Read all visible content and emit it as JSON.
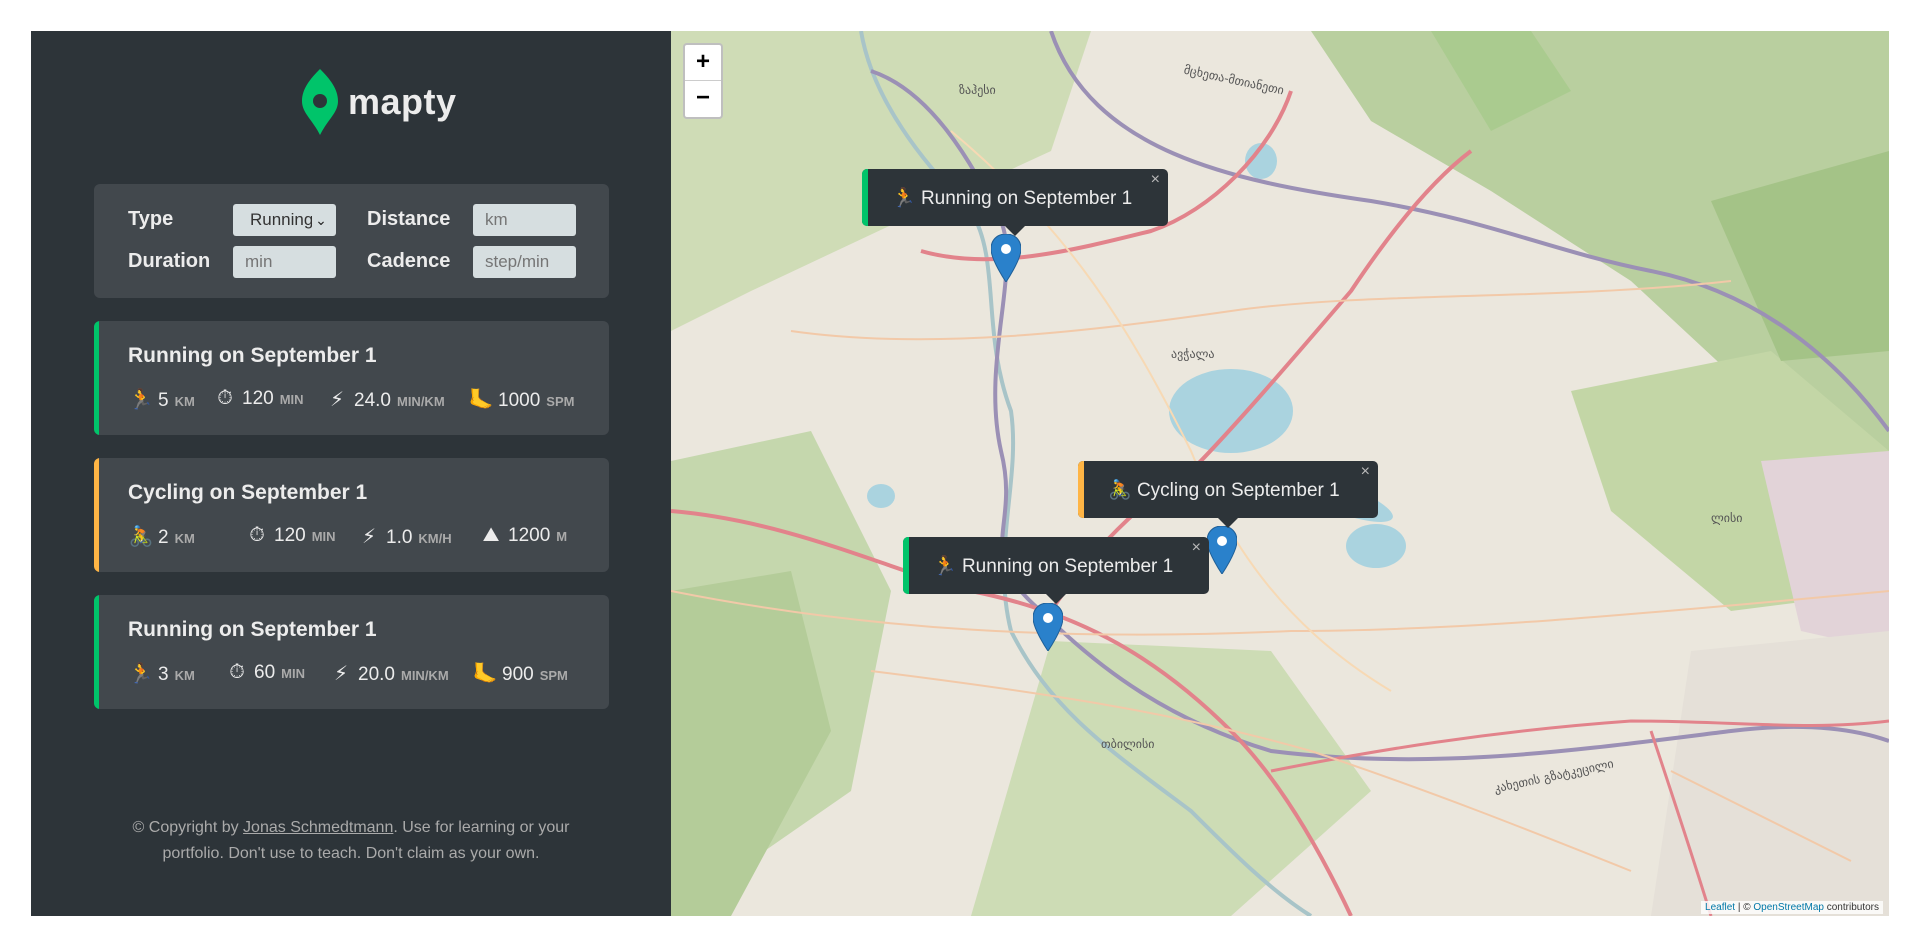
{
  "brand": {
    "name": "mapty",
    "accent": "#00c46a"
  },
  "form": {
    "type_label": "Type",
    "type_value": "Running",
    "distance_label": "Distance",
    "distance_placeholder": "km",
    "duration_label": "Duration",
    "duration_placeholder": "min",
    "cadence_label": "Cadence",
    "cadence_placeholder": "step/min"
  },
  "workouts": [
    {
      "title": "Running on September 1",
      "color": "#00c46a",
      "details": [
        {
          "icon": "🏃",
          "value": "5",
          "unit": "km"
        },
        {
          "icon": "⏱",
          "value": "120",
          "unit": "min"
        },
        {
          "icon": "⚡",
          "value": "24.0",
          "unit": "min/km"
        },
        {
          "icon": "🦶",
          "value": "1000",
          "unit": "spm"
        }
      ]
    },
    {
      "title": "Cycling on September 1",
      "color": "#ffb545",
      "details": [
        {
          "icon": "🚴",
          "value": "2",
          "unit": "km"
        },
        {
          "icon": "⏱",
          "value": "120",
          "unit": "min"
        },
        {
          "icon": "⚡",
          "value": "1.0",
          "unit": "km/h"
        },
        {
          "icon": "⛰",
          "value": "1200",
          "unit": "m"
        }
      ]
    },
    {
      "title": "Running on September 1",
      "color": "#00c46a",
      "details": [
        {
          "icon": "🏃",
          "value": "3",
          "unit": "km"
        },
        {
          "icon": "⏱",
          "value": "60",
          "unit": "min"
        },
        {
          "icon": "⚡",
          "value": "20.0",
          "unit": "min/km"
        },
        {
          "icon": "🦶",
          "value": "900",
          "unit": "spm"
        }
      ]
    }
  ],
  "copyright": {
    "prefix": "© Copyright by ",
    "author": "Jonas Schmedtmann",
    "suffix": ". Use for learning or your portfolio. Don't use to teach. Don't claim as your own."
  },
  "map": {
    "zoom_in": "+",
    "zoom_out": "−",
    "popups": [
      {
        "icon": "🏃",
        "text": "Running on September 1",
        "color": "#00c46a"
      },
      {
        "icon": "🚴",
        "text": "Cycling on September 1",
        "color": "#ffb545"
      },
      {
        "icon": "🏃",
        "text": "Running on September 1",
        "color": "#00c46a"
      }
    ],
    "close_glyph": "×",
    "attribution": {
      "leaflet": "Leaflet",
      "sep": " | © ",
      "osm": "OpenStreetMap",
      "suffix": " contributors"
    },
    "labels": [
      "ზაჰესი",
      "მცხეთა-მთიანეთი",
      "თბილისი",
      "კახეთის გზატკეცილი",
      "ლისი",
      "ავჭალა"
    ]
  }
}
